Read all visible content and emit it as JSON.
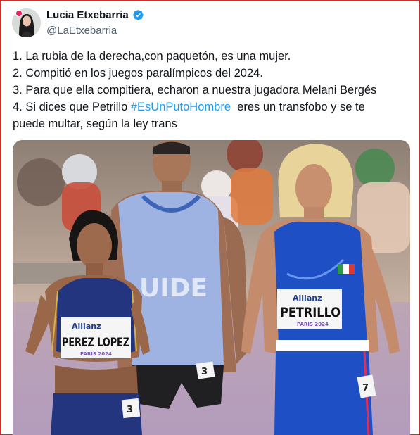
{
  "author": {
    "display_name": "Lucia Etxebarria",
    "handle": "@LaEtxebarria",
    "verified": true,
    "avatar_icon": "avatar-portrait",
    "verified_icon": "verified-badge-icon",
    "verified_color": "#1d9bf0"
  },
  "tweet": {
    "line1": "1. La rubia de la derecha,con paquetón, es una mujer.",
    "line2": "2. Compitió en los juegos paralímpicos del 2024.",
    "line3": "3. Para que ella compitiera, echaron a nuestra jugadora Melani Bergés",
    "line4_before": "4. Si dices que Petrillo ",
    "hashtag": "#EsUnPutoHombre",
    "line4_after": "  eres un transfobo y se te",
    "line5": "puede multar, según la ley trans"
  },
  "media": {
    "bib_left_sponsor": "Allianz",
    "bib_left_name": "PEREZ LOPEZ",
    "bib_left_event": "PARIS 2024",
    "bib_right_sponsor": "Allianz",
    "bib_right_name": "PETRILLO",
    "bib_right_event": "PARIS 2024",
    "guide_vest_text": "UIDE",
    "hip_number_left": "3",
    "hip_number_right": "7",
    "hip_number_guide": "3"
  },
  "colors": {
    "hashtag": "#1d9bf0",
    "text": "#0f1419",
    "handle": "#536471",
    "italy_blue": "#1f4fc4",
    "guide_vest": "#9fb6ea"
  }
}
